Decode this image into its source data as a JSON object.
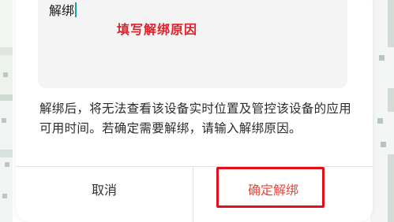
{
  "input": {
    "value": "解绑",
    "annotation": "填写解绑原因"
  },
  "message": "解绑后，将无法查看该设备实时位置及管控该设备的应用可用时间。若确定需要解绑，请输入解绑原因。",
  "buttons": {
    "cancel": "取消",
    "confirm": "确定解绑"
  },
  "colors": {
    "confirm_text": "#e8453c",
    "annotation": "#e0202a",
    "highlight_border": "#e0101a",
    "caret": "#1aa39a"
  }
}
